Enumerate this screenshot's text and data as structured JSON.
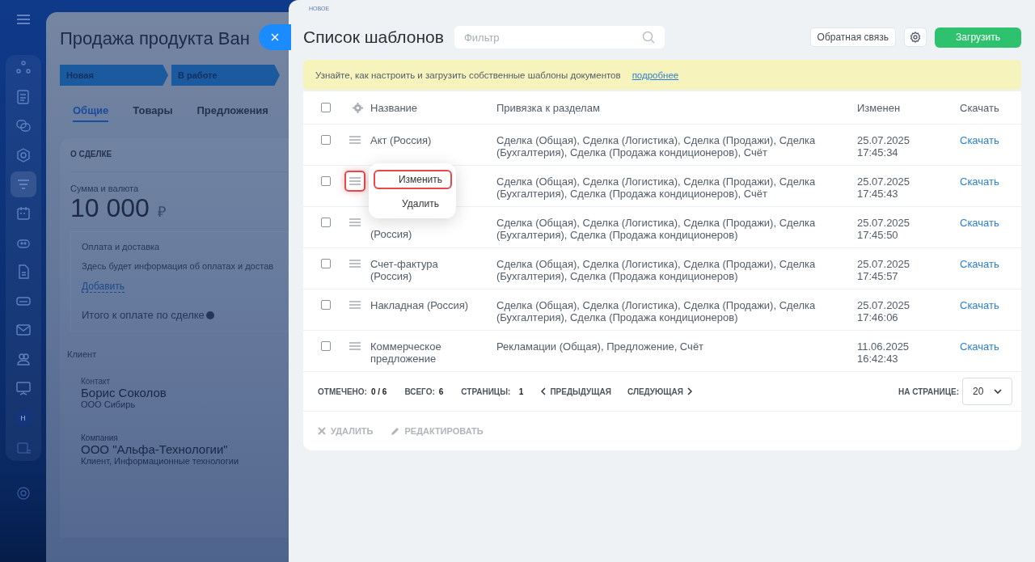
{
  "background_page": {
    "badge": "НОВОЕ",
    "deal_title": "Продажа продукта Ван",
    "stages": [
      {
        "label": "Новая"
      },
      {
        "label": "В работе"
      }
    ],
    "tabs": [
      {
        "label": "Общие",
        "selected": true
      },
      {
        "label": "Товары",
        "selected": false
      },
      {
        "label": "Предложения",
        "selected": false
      }
    ],
    "section_title": "О СДЕЛКЕ",
    "amount_label": "Сумма и валюта",
    "amount": "10 000",
    "currency": "₽",
    "payment_title": "Оплата и доставка",
    "payment_text": "Здесь будет информация об оплатах и достав",
    "add_link": "Добавить",
    "total_label": "Итого к оплате по сделке",
    "client_title": "Клиент",
    "contact_label": "Контакт",
    "contact_name": "Борис Соколов",
    "contact_company": "ООО Сибирь",
    "company_label": "Компания",
    "company_name": "ООО \"Альфа-Технологии\"",
    "company_info": "Клиент, Информационные технологии"
  },
  "sidebar": {
    "avatar": "Н"
  },
  "panel": {
    "title": "Список шаблонов",
    "filter": {
      "placeholder": "Фильтр"
    },
    "feedback_button": "Обратная связь",
    "upload_button": "Загрузить",
    "banner": {
      "text": "Узнайте, как настроить и загрузить собственные шаблоны документов",
      "link": "подробнее"
    },
    "table": {
      "columns": [
        "Название",
        "Привязка к разделам",
        "Изменен",
        "Скачать"
      ],
      "rows": [
        {
          "name": "Акт (Россия)",
          "name_covered": false,
          "binding": "Сделка (Общая), Сделка (Логистика), Сделка (Продажи), Сделка\n(Бухгалтерия), Сделка (Продажа кондиционеров), Счёт",
          "changed": "25.07.2025\n17:45:34",
          "download": "Скачать",
          "checked": false,
          "highlighted": false
        },
        {
          "name_covered": true,
          "binding": "Сделка (Общая), Сделка (Логистика), Сделка (Продажи), Сделка\n(Бухгалтерия), Сделка (Продажа кондиционеров), Счёт",
          "changed": "25.07.2025\n17:45:43",
          "download": "Скачать",
          "checked": false,
          "highlighted": true,
          "menu_open": true
        },
        {
          "name": "(Россия)",
          "name_covered": true,
          "binding": "Сделка (Общая), Сделка (Логистика), Сделка (Продажи), Сделка\n(Бухгалтерия), Сделка (Продажа кондиционеров)",
          "changed": "25.07.2025\n17:45:50",
          "download": "Скачать",
          "checked": false,
          "highlighted": false
        },
        {
          "name": "Счет-фактура\n(Россия)",
          "name_covered": false,
          "binding": "Сделка (Общая), Сделка (Логистика), Сделка (Продажи), Сделка\n(Бухгалтерия), Сделка (Продажа кондиционеров)",
          "changed": "25.07.2025\n17:45:57",
          "download": "Скачать",
          "checked": false,
          "highlighted": false
        },
        {
          "name": "Накладная (Россия)",
          "name_covered": false,
          "binding": "Сделка (Общая), Сделка (Логистика), Сделка (Продажи), Сделка\n(Бухгалтерия), Сделка (Продажа кондиционеров)",
          "changed": "25.07.2025\n17:46:06",
          "download": "Скачать",
          "checked": false,
          "highlighted": false
        },
        {
          "name": "Коммерческое\nпредложение",
          "name_covered": false,
          "binding": "Рекламации (Общая), Предложение, Счёт",
          "changed": "11.06.2025\n16:42:43",
          "download": "Скачать",
          "checked": false,
          "highlighted": false
        }
      ],
      "select_all_checked": false,
      "context_menu": {
        "items": [
          {
            "label": "Изменить",
            "highlighted": true
          },
          {
            "label": "Удалить",
            "highlighted": false
          }
        ]
      },
      "footer": {
        "checked_label": "ОТМЕЧЕНО:",
        "checked_value": "0 / 6",
        "total_label": "ВСЕГО:",
        "total_value": "6",
        "pages_label": "СТРАНИЦЫ:",
        "pages_value": "1",
        "prev": "ПРЕДЫДУЩАЯ",
        "next": "СЛЕДУЮЩАЯ",
        "per_page_label": "НА СТРАНИЦЕ:",
        "per_page": "20"
      },
      "actions": [
        {
          "label": "УДАЛИТЬ",
          "kind": "delete",
          "disabled": true
        },
        {
          "label": "РЕДАКТИРОВАТЬ",
          "kind": "edit",
          "disabled": true
        }
      ]
    }
  }
}
